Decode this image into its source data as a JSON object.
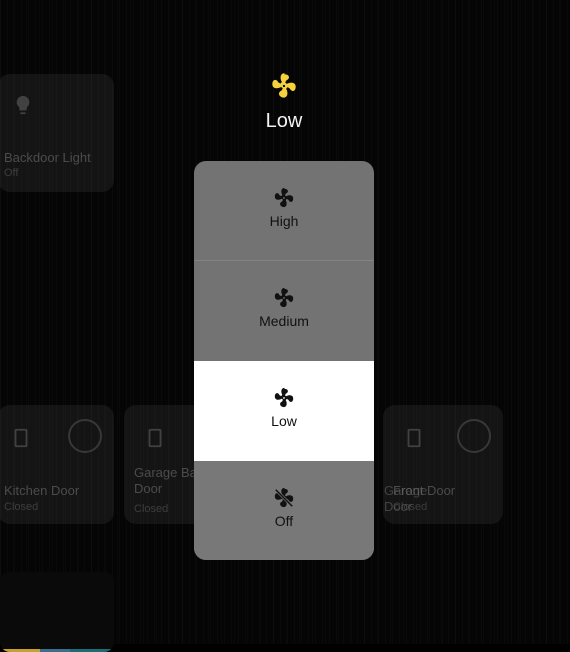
{
  "dialog": {
    "current_state": "Low",
    "fan_icon": "fan-icon",
    "accent_color": "#f4d13d"
  },
  "speeds": {
    "selected": "Low",
    "options": [
      {
        "label": "High"
      },
      {
        "label": "Medium"
      },
      {
        "label": "Low"
      },
      {
        "label": "Off"
      }
    ]
  },
  "background_cards": {
    "backdoor_light": {
      "name": "Backdoor Light",
      "state": "Off",
      "icon": "lightbulb-icon"
    },
    "kitchen_door": {
      "name": "Kitchen Door",
      "state": "Closed",
      "icon": "door-icon"
    },
    "garage_back_door": {
      "name": "Garage Back Door",
      "state": "Closed",
      "icon": "door-icon"
    },
    "garage_door": {
      "name": "Garage Door",
      "state": "Closed",
      "icon": "door-icon"
    },
    "front_door": {
      "name": "Front Door",
      "state": "Closed",
      "icon": "door-icon"
    }
  }
}
